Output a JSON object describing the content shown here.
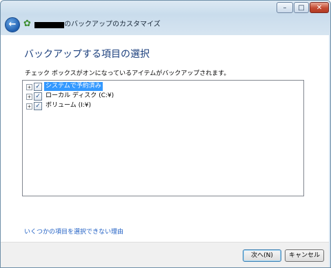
{
  "window": {
    "title_suffix": "のバックアップのカスタマイズ",
    "caption_buttons": {
      "minimize": "–",
      "maximize": "□",
      "close": "✕"
    },
    "back_icon_glyph": "←",
    "app_icon_glyph": "✿"
  },
  "page": {
    "heading": "バックアップする項目の選択",
    "instruction": "チェック ボックスがオンになっているアイテムがバックアップされます。",
    "tree_items": [
      {
        "label": "システムで予約済み",
        "checked": true,
        "selected": true,
        "expander": "+"
      },
      {
        "label": "ローカル ディスク (C:¥)",
        "checked": true,
        "selected": false,
        "expander": "+"
      },
      {
        "label": "ボリューム (I:¥)",
        "checked": true,
        "selected": false,
        "expander": "+"
      }
    ],
    "checkbox_glyph": "✓",
    "help_link": "いくつかの項目を選択できない理由"
  },
  "footer": {
    "next_label": "次へ(N)",
    "cancel_label": "キャンセル"
  },
  "colors": {
    "heading": "#1a3e7c",
    "link": "#1f5fc4",
    "selection": "#3399ff",
    "close_button": "#c44a32"
  }
}
